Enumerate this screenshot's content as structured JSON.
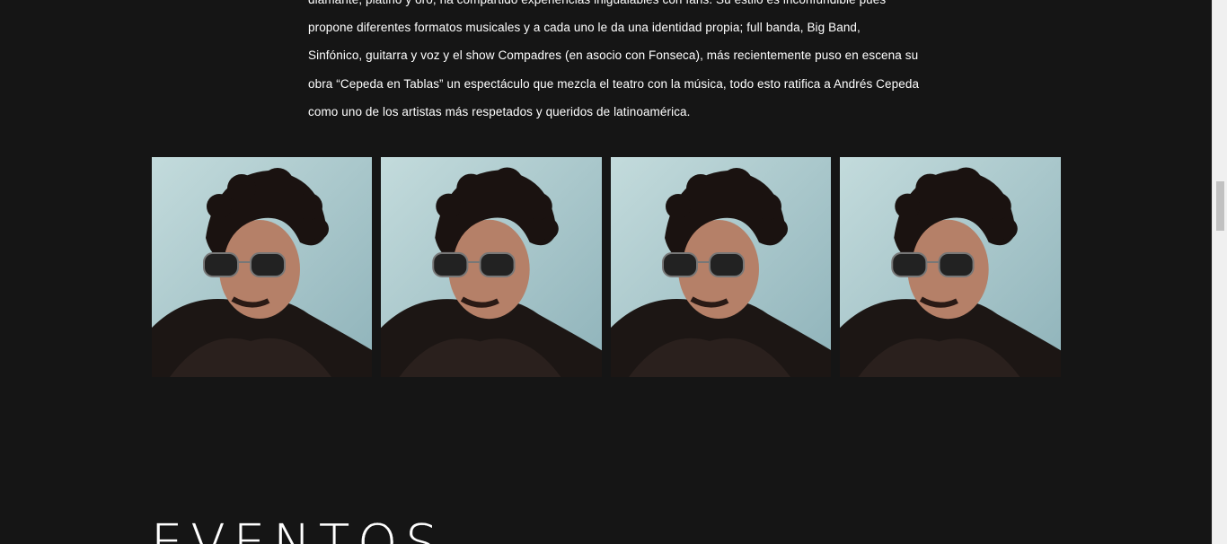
{
  "bio": {
    "lines": [
      "diamante, platino y oro, ha compartido experiencias inigualables con fans. Su estilo es inconfundible pues",
      "propone diferentes formatos musicales y a cada uno le da una identidad propia; full banda, Big Band,",
      "Sinfónico, guitarra y voz y el show Compadres (en asocio con Fonseca), más recientemente puso en escena su",
      "obra “Cepeda en Tablas” un espectáculo que mezcla el teatro con la música, todo esto ratifica a Andrés Cepeda",
      "como uno de los artistas más respetados y queridos de latinoamérica."
    ]
  },
  "gallery": {
    "photos": [
      {
        "subject": "artist-portrait"
      },
      {
        "subject": "artist-portrait"
      },
      {
        "subject": "artist-portrait"
      },
      {
        "subject": "artist-portrait"
      }
    ]
  },
  "events": {
    "title": "EVENTOS"
  },
  "colors": {
    "background": "#151515",
    "text": "#ffffff",
    "photo_backdrop": "#a9c9cc",
    "scrollbar_track": "#f0f0f0",
    "scrollbar_thumb": "#c1c1c1"
  }
}
